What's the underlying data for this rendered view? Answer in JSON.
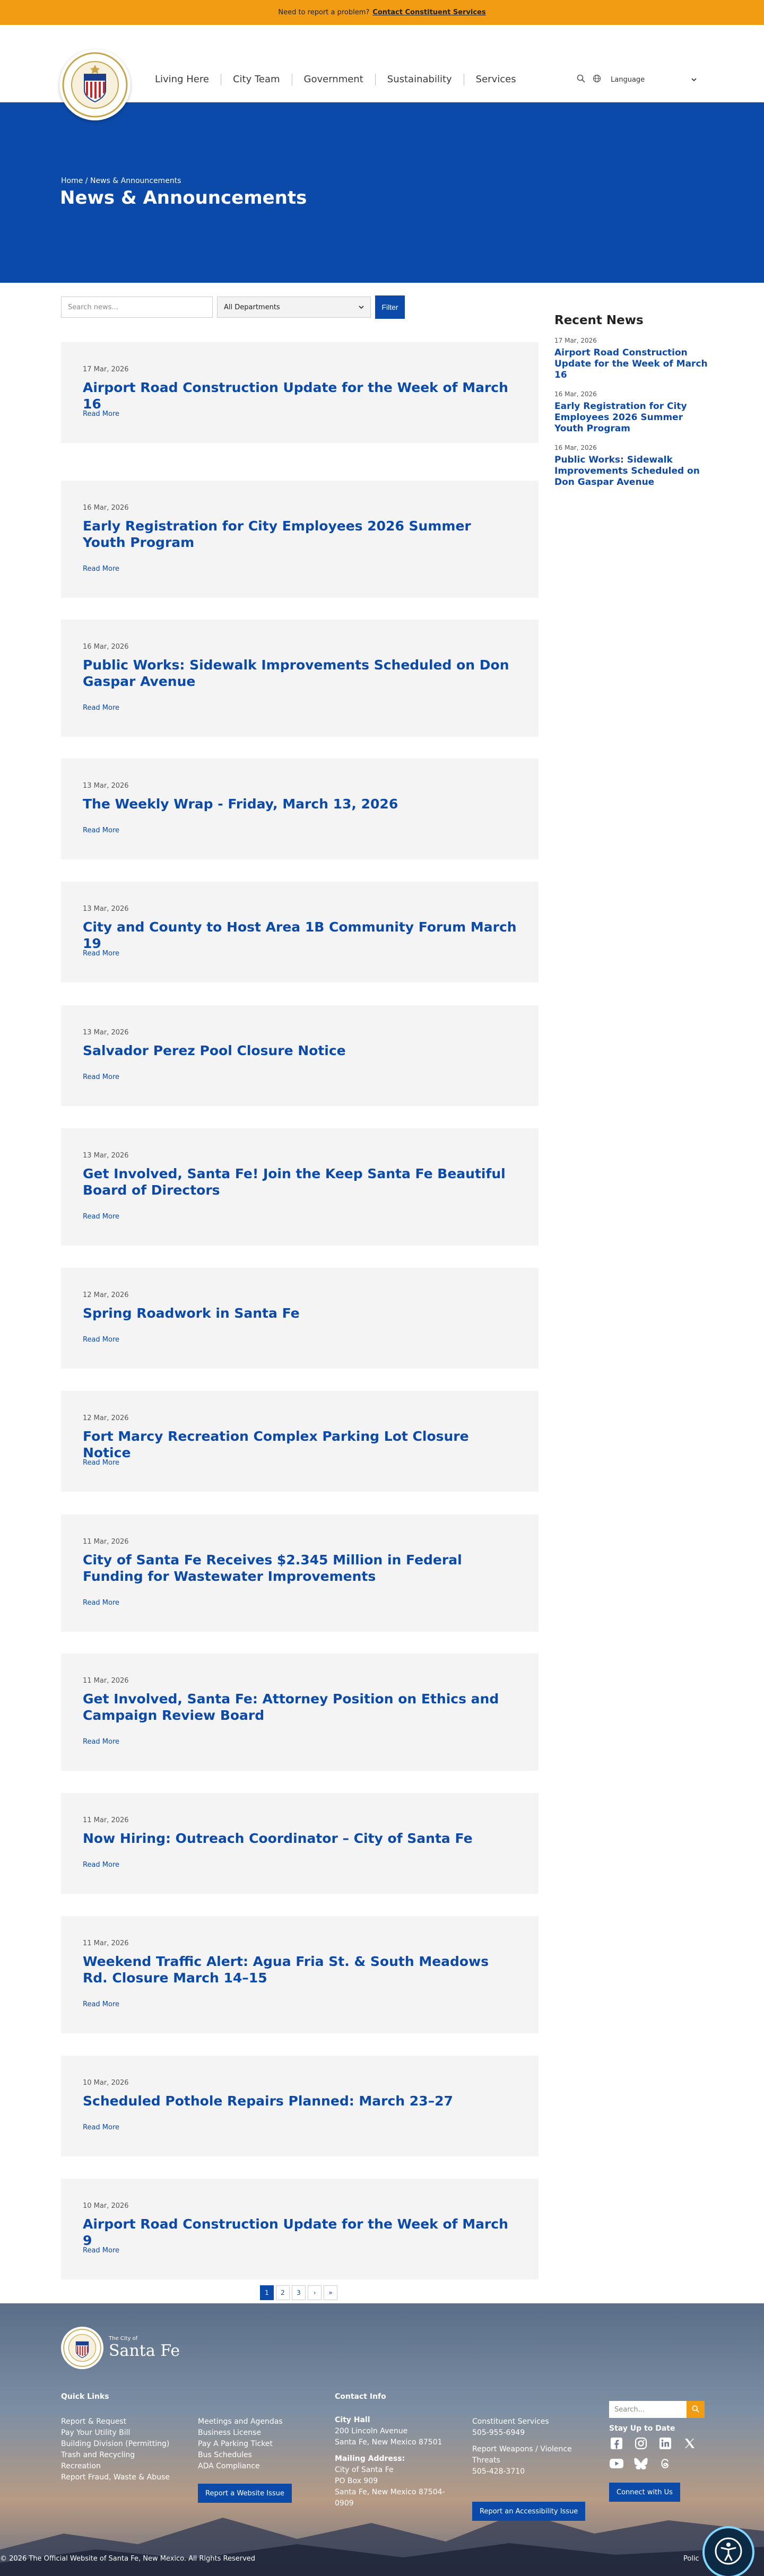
{
  "alert": {
    "text": "Need to report a problem?",
    "link": "Contact Constituent Services"
  },
  "header": {
    "nav": [
      "Living Here",
      "City Team",
      "Government",
      "Sustainability",
      "Services"
    ],
    "language_label": "Language"
  },
  "hero": {
    "crumb_home": "Home",
    "crumb_sep": "/",
    "crumb_current": "News & Announcements",
    "title": "News & Announcements"
  },
  "filters": {
    "search_placeholder": "Search news...",
    "department_selected": "All Departments",
    "filter_label": "Filter"
  },
  "news": [
    {
      "date": "17 Mar, 2026",
      "title": "Airport Road Construction Update for the Week of March 16",
      "read_more": "Read More"
    },
    {
      "date": "16 Mar, 2026",
      "title": "Early Registration for City Employees 2026 Summer Youth Program",
      "read_more": "Read More"
    },
    {
      "date": "16 Mar, 2026",
      "title": "Public Works: Sidewalk Improvements Scheduled on Don Gaspar Avenue",
      "read_more": "Read More"
    },
    {
      "date": "13 Mar, 2026",
      "title": "The Weekly Wrap - Friday, March 13, 2026",
      "read_more": "Read More"
    },
    {
      "date": "13 Mar, 2026",
      "title": "City and County to Host Area 1B Community Forum March 19",
      "read_more": "Read More"
    },
    {
      "date": "13 Mar, 2026",
      "title": "Salvador Perez Pool Closure Notice",
      "read_more": "Read More"
    },
    {
      "date": "13 Mar, 2026",
      "title": "Get Involved, Santa Fe! Join the Keep Santa Fe Beautiful Board of Directors",
      "read_more": "Read More"
    },
    {
      "date": "12 Mar, 2026",
      "title": "Spring Roadwork in Santa Fe",
      "read_more": "Read More"
    },
    {
      "date": "12 Mar, 2026",
      "title": "Fort Marcy Recreation Complex Parking Lot Closure Notice",
      "read_more": "Read More"
    },
    {
      "date": "11 Mar, 2026",
      "title": "City of Santa Fe Receives $2.345 Million in Federal Funding for Wastewater Improvements",
      "read_more": "Read More"
    },
    {
      "date": "11 Mar, 2026",
      "title": "Get Involved, Santa Fe: Attorney Position on Ethics and Campaign Review Board",
      "read_more": "Read More"
    },
    {
      "date": "11 Mar, 2026",
      "title": "Now Hiring: Outreach Coordinator – City of Santa Fe",
      "read_more": "Read More"
    },
    {
      "date": "11 Mar, 2026",
      "title": "Weekend Traffic Alert: Agua Fria St. & South Meadows Rd. Closure March 14–15",
      "read_more": "Read More"
    },
    {
      "date": "10 Mar, 2026",
      "title": "Scheduled Pothole Repairs Planned: March 23–27",
      "read_more": "Read More"
    },
    {
      "date": "10 Mar, 2026",
      "title": "Airport Road Construction Update for the Week of March 9",
      "read_more": "Read More"
    }
  ],
  "sidebar": {
    "heading": "Recent News",
    "items": [
      {
        "date": "17 Mar, 2026",
        "title": "Airport Road Construction Update for the Week of March 16"
      },
      {
        "date": "16 Mar, 2026",
        "title": "Early Registration for City Employees 2026 Summer Youth Program"
      },
      {
        "date": "16 Mar, 2026",
        "title": "Public Works: Sidewalk Improvements Scheduled on Don Gaspar Avenue"
      }
    ]
  },
  "pagination": {
    "pages": [
      "1",
      "2",
      "3"
    ],
    "next": "›",
    "last": "»",
    "current": "1"
  },
  "footer": {
    "logo_small": "The City of",
    "logo_name": "Santa Fe",
    "quick_links_heading": "Quick Links",
    "links_col1": [
      "Report & Request",
      "Pay Your Utility Bill",
      "Building Division (Permitting)",
      "Trash and Recycling",
      "Recreation",
      "Report Fraud, Waste & Abuse"
    ],
    "links_col2": [
      "Meetings and Agendas",
      "Business License",
      "Pay A Parking Ticket",
      "Bus Schedules",
      "ADA Compliance"
    ],
    "report_website_issue": "Report a Website Issue",
    "contact_heading": "Contact Info",
    "city_hall_label": "City Hall",
    "city_hall_address": [
      "200 Lincoln Avenue",
      "Santa Fe, New Mexico 87501"
    ],
    "mailing_label": "Mailing Address:",
    "mailing_address": [
      "City of Santa Fe",
      "PO Box 909",
      "Santa Fe, New Mexico 87504-",
      "0909"
    ],
    "constituent_label": "Constituent Services",
    "constituent_phone": "505-955-6949",
    "weapons_label": "Report Weapons / Violence Threats",
    "weapons_phone": "505-428-3710",
    "report_accessibility": "Report an Accessibility Issue",
    "search_placeholder": "Search...",
    "stay_heading": "Stay Up to Date",
    "connect": "Connect with Us",
    "copyright": "© 2026 The Official Website of Santa Fe, New Mexico. All Rights Reserved",
    "policies": "Polic"
  },
  "colors": {
    "brand_blue": "#0b4aa8",
    "accent_orange": "#f29c13",
    "card_bg": "#f4f4f4"
  }
}
